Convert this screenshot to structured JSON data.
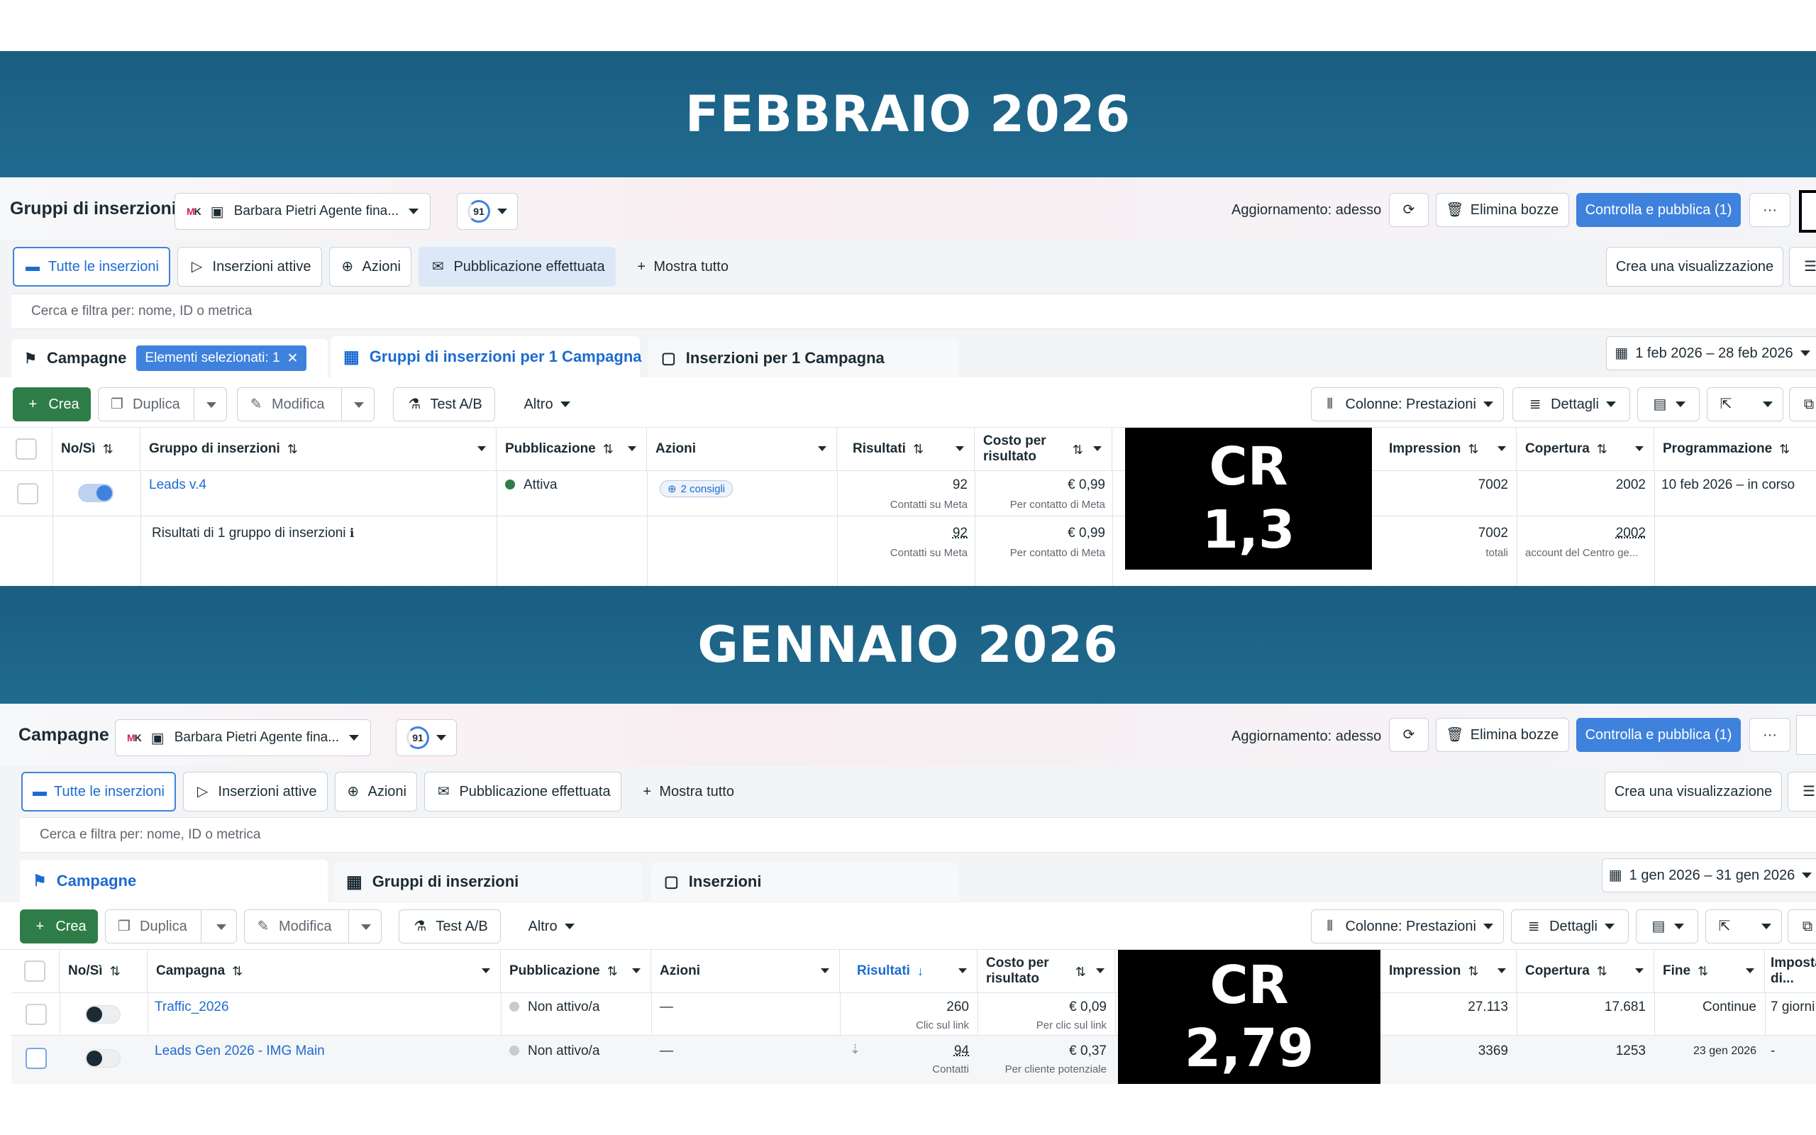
{
  "banners": {
    "feb": "FEBBRAIO 2026",
    "jan": "GENNAIO 2026"
  },
  "common": {
    "account_name": "Barbara Pietri Agente fina...",
    "account_logo": "MK",
    "score": "91",
    "update_status": "Aggiornamento: adesso",
    "delete_drafts": "Elimina bozze",
    "review_publish": "Controlla e pubblica (1)",
    "more": "···",
    "filter_all": "Tutte le inserzioni",
    "filter_active": "Inserzioni attive",
    "filter_actions": "Azioni",
    "filter_published": "Pubblicazione effettuata",
    "show_all": "Mostra tutto",
    "create_view": "Crea una visualizzazione",
    "search_placeholder": "Cerca e filtra per: nome, ID o metrica",
    "create": "Crea",
    "duplicate": "Duplica",
    "edit": "Modifica",
    "ab_test": "Test A/B",
    "other": "Altro",
    "columns": "Colonne: Prestazioni",
    "details": "Dettagli",
    "col_onoff": "No/Sì",
    "col_publication": "Pubblicazione",
    "col_actions": "Azioni",
    "col_results": "Risultati",
    "col_cost": "Costo per risultato",
    "col_impressions": "Impression",
    "col_reach": "Copertura",
    "cr_label": "CR"
  },
  "feb": {
    "page_title": "Gruppi di inserzioni",
    "tabs": {
      "campaigns": "Campagne",
      "selected_chip": "Elementi selezionati: 1",
      "adsets": "Gruppi di inserzioni per 1 Campagna",
      "ads": "Inserzioni per 1 Campagna"
    },
    "date_range": "1 feb 2026 – 28 feb 2026",
    "col_name": "Gruppo di inserzioni",
    "col_schedule": "Programmazione",
    "cr_value": "1,3",
    "row": {
      "name": "Leads v.4",
      "status": "Attiva",
      "actions_pill": "2 consigli",
      "results": "92",
      "results_sub": "Contatti su Meta",
      "cost": "€ 0,99",
      "cost_sub": "Per contatto di Meta",
      "impressions": "7002",
      "reach": "2002",
      "schedule": "10 feb 2026 – in corso"
    },
    "summary": {
      "label": "Risultati di 1 gruppo di inserzioni",
      "results": "92",
      "results_sub": "Contatti su Meta",
      "cost": "€ 0,99",
      "cost_sub": "Per contatto di Meta",
      "impressions": "7002",
      "impressions_sub": "totali",
      "reach": "2002",
      "reach_sub": "account del Centro ge..."
    }
  },
  "jan": {
    "page_title": "Campagne",
    "tabs": {
      "campaigns": "Campagne",
      "adsets": "Gruppi di inserzioni",
      "ads": "Inserzioni"
    },
    "date_range": "1 gen 2026 – 31 gen 2026",
    "col_name": "Campagna",
    "col_end": "Fine",
    "col_budget": "Imposta di...",
    "cr_value": "2,79",
    "rows": [
      {
        "name": "Traffic_2026",
        "status": "Non attivo/a",
        "actions": "—",
        "results": "260",
        "results_sub": "Clic sul link",
        "cost": "€ 0,09",
        "cost_sub": "Per clic sul link",
        "impressions": "27.113",
        "reach": "17.681",
        "end": "Continue",
        "budget": "7 giorni"
      },
      {
        "name": "Leads Gen 2026 - IMG Main",
        "status": "Non attivo/a",
        "actions": "—",
        "results": "94",
        "results_sub": "Contatti",
        "cost": "€ 0,37",
        "cost_sub": "Per cliente potenziale",
        "impressions": "3369",
        "reach": "1253",
        "end": "23 gen 2026",
        "budget": "-"
      }
    ]
  },
  "colors": {
    "banner": "#1f6b8f",
    "primary_blue": "#3f82dd",
    "create_green": "#2e7d48",
    "active_dot": "#2e7d48",
    "inactive_dot": "#c6cbd1"
  }
}
